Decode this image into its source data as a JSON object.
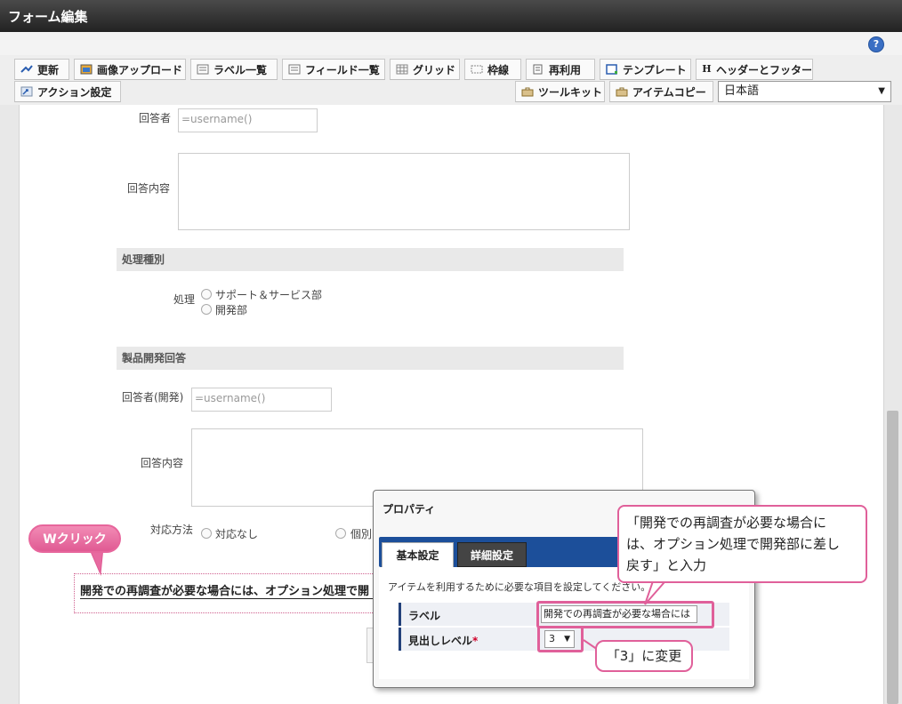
{
  "window": {
    "title": "フォーム編集"
  },
  "help": {
    "label": "?"
  },
  "toolbar": {
    "items": [
      {
        "label": "更新",
        "icon": "update-icon"
      },
      {
        "label": "画像アップロード",
        "icon": "image-upload-icon"
      },
      {
        "label": "ラベル一覧",
        "icon": "label-list-icon"
      },
      {
        "label": "フィールド一覧",
        "icon": "field-list-icon"
      },
      {
        "label": "グリッド",
        "icon": "grid-icon"
      },
      {
        "label": "枠線",
        "icon": "border-icon"
      },
      {
        "label": "再利用",
        "icon": "reuse-icon"
      },
      {
        "label": "テンプレート",
        "icon": "template-icon"
      },
      {
        "label": "ヘッダーとフッター",
        "icon": "header-footer-icon"
      },
      {
        "label": "アクション設定",
        "icon": "action-icon"
      },
      {
        "label": "ツールキット",
        "icon": "toolkit-icon"
      },
      {
        "label": "アイテムコピー",
        "icon": "item-copy-icon"
      }
    ],
    "h_glyph": "H",
    "language": "日本語",
    "language_arrow": "▼"
  },
  "form": {
    "respondent_label": "回答者",
    "respondent_placeholder": "=username()",
    "answer_label": "回答内容",
    "section1": "処理種別",
    "process_label": "処理",
    "process_options": [
      "サポート＆サービス部",
      "開発部"
    ],
    "section2": "製品開発回答",
    "dev_respondent_label": "回答者(開発)",
    "dev_respondent_placeholder": "=username()",
    "dev_answer_label": "回答内容",
    "response_label": "対応方法",
    "response_options": [
      "対応なし",
      "個別"
    ],
    "heading_text": "開発での再調査が必要な場合には、オプション処理で開"
  },
  "annotations": {
    "double_click": "Wクリック",
    "label_note_lines": [
      "「開発での再調査が必要な場合に",
      "は、オプション処理で開発部に差し",
      "戻す」と入力"
    ],
    "level_note": "「3」に変更"
  },
  "dialog": {
    "title": "プロパティ",
    "tabs": [
      "基本設定",
      "詳細設定"
    ],
    "description": "アイテムを利用するために必要な項目を設定してください。",
    "label_field": "ラベル",
    "label_value": "開発での再調査が必要な場合には",
    "level_field": "見出しレベル",
    "required_mark": "*",
    "level_value": "3",
    "level_arrow": "▼"
  }
}
